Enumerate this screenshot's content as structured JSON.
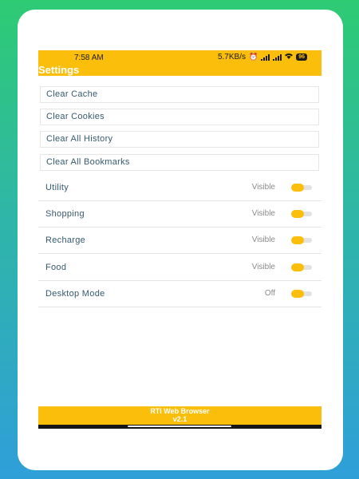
{
  "status_bar": {
    "time": "7:58 AM",
    "network_speed": "5.7KB/s",
    "battery": "96"
  },
  "appbar": {
    "title": "Settings"
  },
  "actions": [
    {
      "label": "Clear Cache"
    },
    {
      "label": "Clear Cookies"
    },
    {
      "label": "Clear All History"
    },
    {
      "label": "Clear All Bookmarks"
    }
  ],
  "toggles": [
    {
      "label": "Utility",
      "status": "Visible"
    },
    {
      "label": "Shopping",
      "status": "Visible"
    },
    {
      "label": "Recharge",
      "status": "Visible"
    },
    {
      "label": "Food",
      "status": "Visible"
    },
    {
      "label": "Desktop Mode",
      "status": "Off"
    }
  ],
  "footer": {
    "app_name": "RTI Web Browser",
    "version": "v2.1"
  },
  "colors": {
    "accent": "#fbbe0b",
    "text": "#355a6e",
    "muted": "#8a8a8a"
  }
}
